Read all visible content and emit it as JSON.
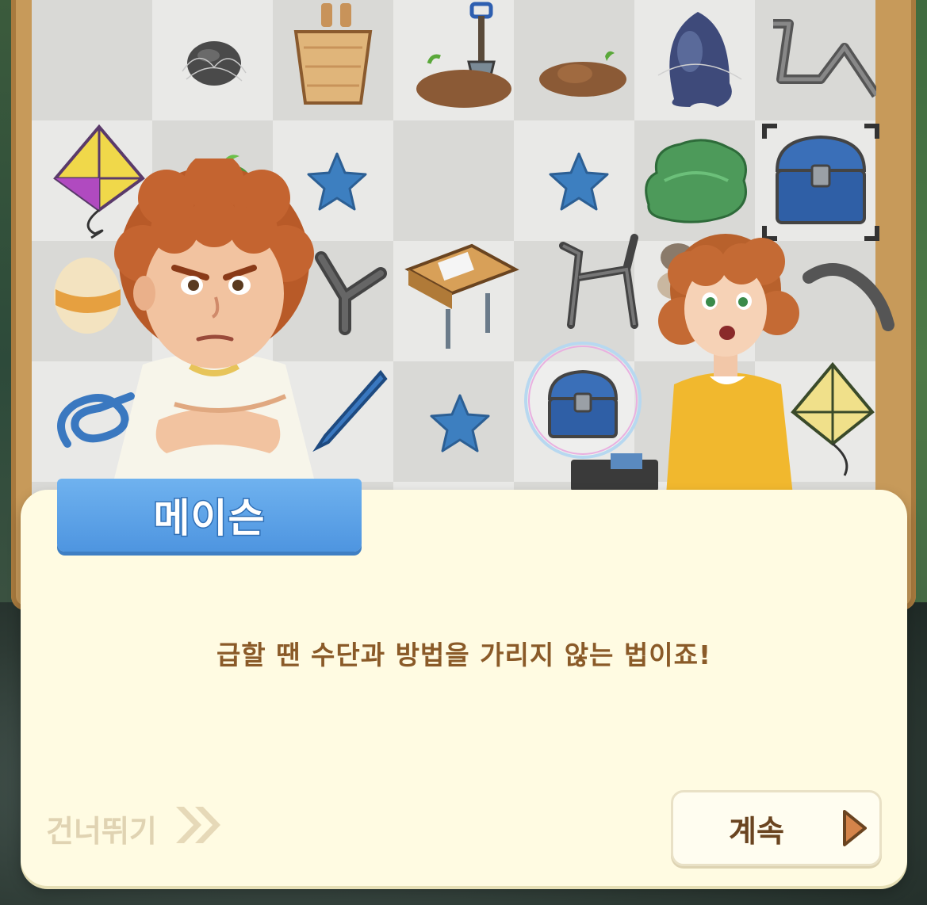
{
  "dialog": {
    "speaker_name": "메이슨",
    "message": "급할 땐 수단과 방법을 가리지 않는 법이죠!",
    "skip_label": "건너뛰기",
    "continue_label": "계속"
  },
  "board": {
    "items": [
      "rock-icon",
      "basket-icon",
      "shovel-in-dirt-icon",
      "dirt-mound-icon",
      "egg-rock-icon",
      "metal-pipe-icon",
      "kite-icon",
      "sprout-icon",
      "blue-star-icon",
      "blue-star-icon",
      "green-slime-icon",
      "treasure-chest-icon",
      "striped-egg-icon",
      "slingshot-icon",
      "school-desk-icon",
      "bicycle-icon",
      "pebbles-icon",
      "bent-pipe-icon",
      "rope-icon",
      "pencil-icon",
      "blue-star-icon",
      "bubble-chest-icon",
      "yellow-kite-icon"
    ]
  },
  "colors": {
    "dialog_bg": "#fffbe2",
    "name_tag": "#5aa2e8",
    "text_brown": "#8a5a28",
    "skip_text": "#e0d3b2",
    "continue_arrow": "#d4844a"
  }
}
